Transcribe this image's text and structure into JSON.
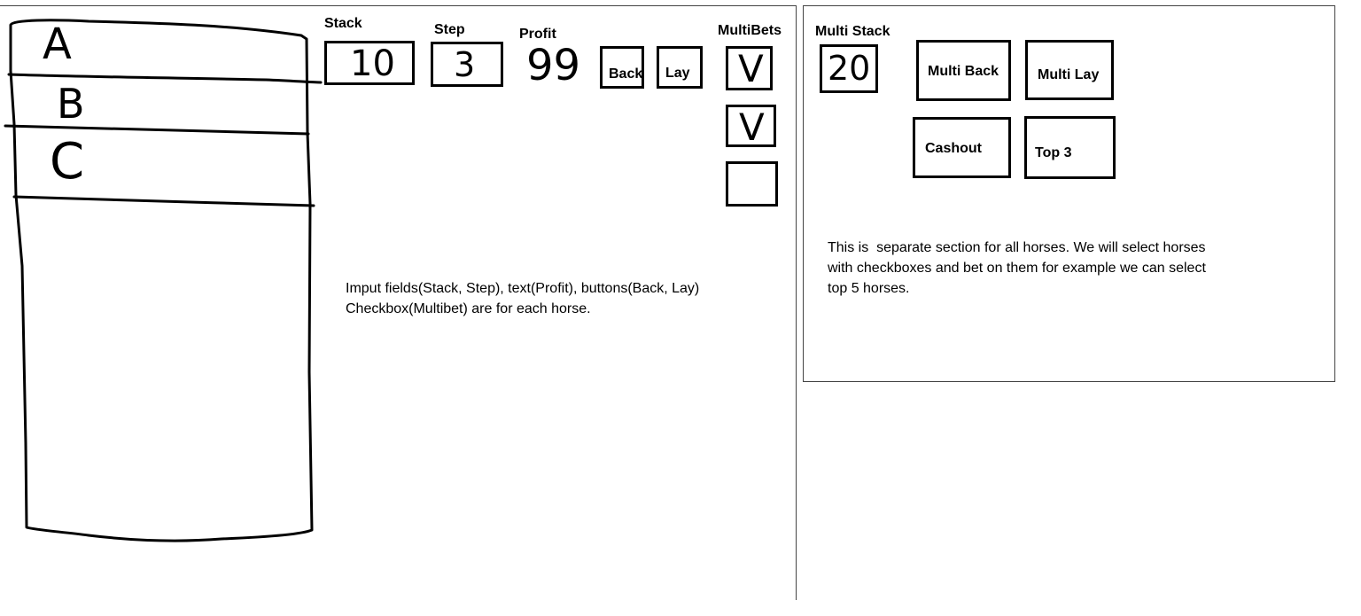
{
  "horses": [
    "A",
    "B",
    "C"
  ],
  "per_horse_controls": {
    "stack_label": "Stack",
    "stack_value": "10",
    "step_label": "Step",
    "step_value": "3",
    "profit_label": "Profit",
    "profit_value": "99",
    "back_label": "Back",
    "lay_label": "Lay",
    "multibets_label": "MultiBets",
    "multibet_marks": [
      "V",
      "V",
      ""
    ]
  },
  "left_note": {
    "line1": "Imput fields(Stack, Step), text(Profit), buttons(Back, Lay)",
    "line2": "Checkbox(Multibet) are for each horse."
  },
  "multi_section": {
    "multi_stack_label": "Multi Stack",
    "multi_stack_value": "20",
    "multi_back_label": "Multi Back",
    "multi_lay_label": "Multi Lay",
    "cashout_label": "Cashout",
    "top3_label": "Top 3",
    "note_line1": "This is  separate section for all horses. We will select horses",
    "note_line2": "with checkboxes and bet on them for example we can select",
    "note_line3": "top 5 horses."
  }
}
